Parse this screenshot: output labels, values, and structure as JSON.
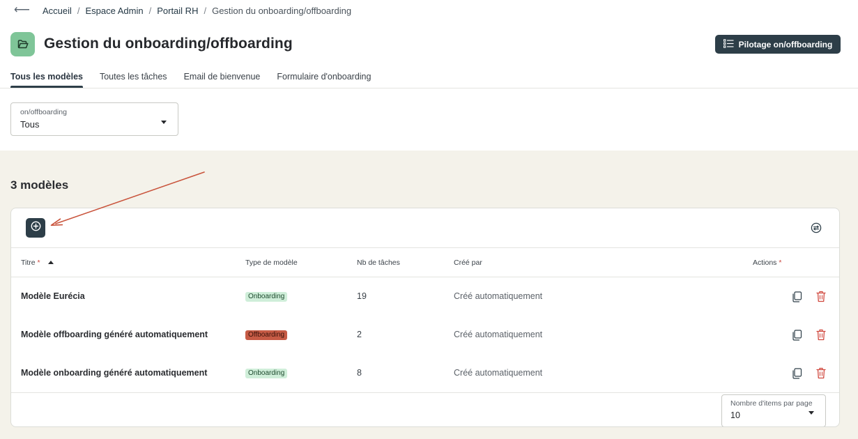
{
  "breadcrumb": {
    "back_icon": "arrow-left-icon",
    "items": [
      "Accueil",
      "Espace Admin",
      "Portail RH",
      "Gestion du onboarding/offboarding"
    ],
    "separator": "/"
  },
  "header": {
    "title": "Gestion du onboarding/offboarding",
    "app_icon": "folder-open-icon",
    "pilot_button_label": "Pilotage on/offboarding",
    "pilot_button_icon": "list-icon"
  },
  "tabs": [
    {
      "label": "Tous les modèles",
      "active": true
    },
    {
      "label": "Toutes les tâches",
      "active": false
    },
    {
      "label": "Email de bienvenue",
      "active": false
    },
    {
      "label": "Formulaire d'onboarding",
      "active": false
    }
  ],
  "filter": {
    "label": "on/offboarding",
    "value": "Tous"
  },
  "list": {
    "count_label": "3 modèles",
    "add_button_icon": "plus-circle-icon",
    "settings_icon": "adjust-columns-icon",
    "columns": {
      "title": "Titre",
      "type": "Type de modèle",
      "tasks": "Nb de tâches",
      "creator": "Créé par",
      "actions": "Actions",
      "required_mark": "*"
    },
    "rows": [
      {
        "title": "Modèle Eurécia",
        "type": "Onboarding",
        "tasks": "19",
        "creator": "Créé automatiquement"
      },
      {
        "title": "Modèle offboarding généré automatiquement",
        "type": "Offboarding",
        "tasks": "2",
        "creator": "Créé automatiquement"
      },
      {
        "title": "Modèle onboarding généré automatiquement",
        "type": "Onboarding",
        "tasks": "8",
        "creator": "Créé automatiquement"
      }
    ],
    "row_actions": {
      "copy_icon": "copy-icon",
      "delete_icon": "trash-icon"
    }
  },
  "pagination": {
    "label": "Nombre d'items par page",
    "value": "10"
  },
  "colors": {
    "primary": "#2d3e48",
    "accent_green": "#7fc598",
    "onboarding_badge": "#cfeed9",
    "offboarding_badge": "#c65b45",
    "danger": "#d0473d",
    "annotation_arrow": "#c9543c"
  }
}
